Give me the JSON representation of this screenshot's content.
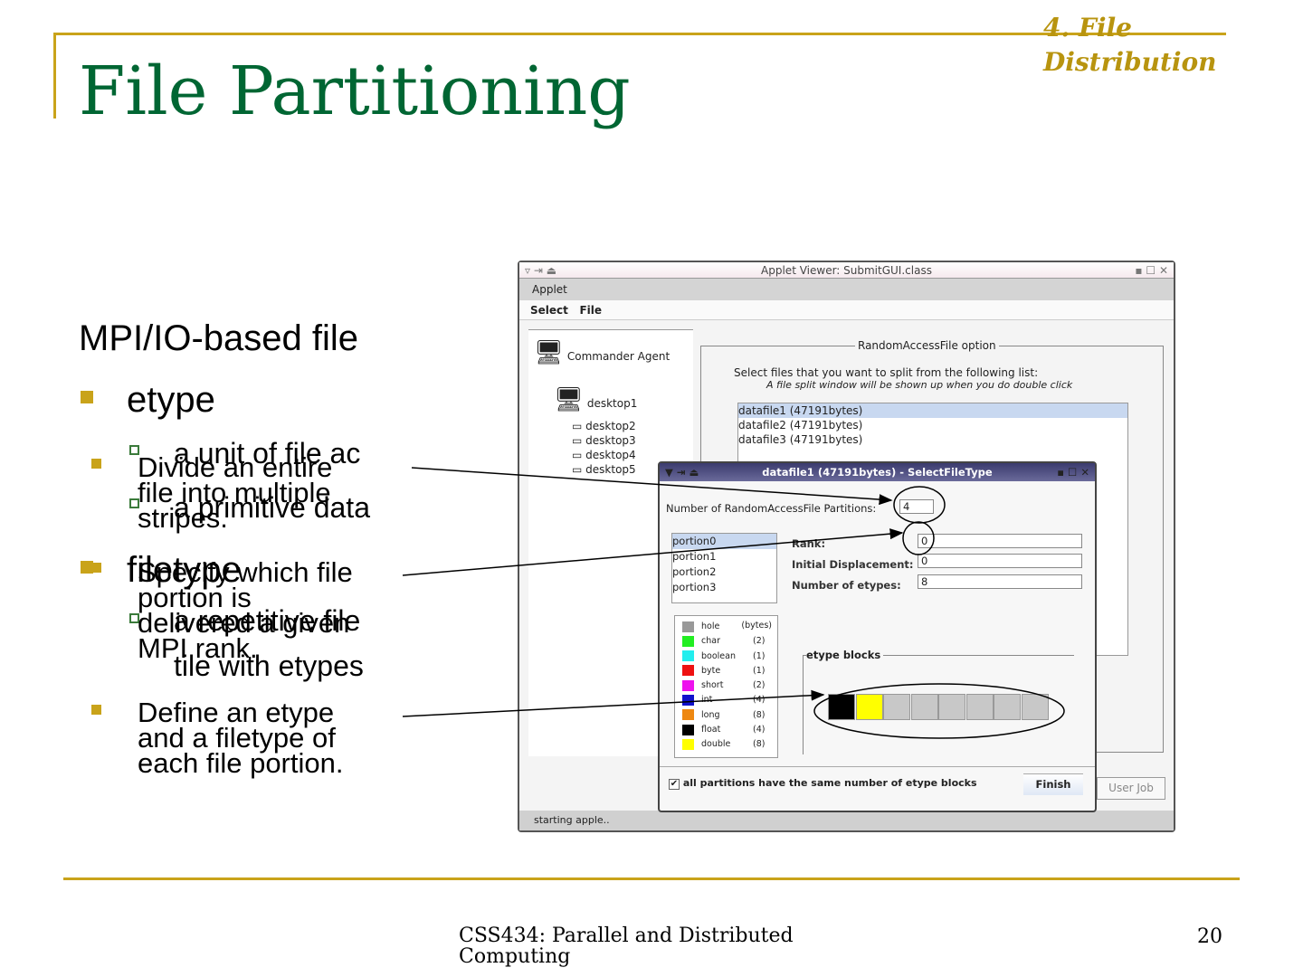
{
  "slide": {
    "title": "File Partitioning",
    "section": [
      "4. File",
      "Distribution"
    ],
    "footer": [
      "CSS434: Parallel and Distributed",
      "Computing"
    ],
    "page_number": "20"
  },
  "background_text": {
    "heading": "MPI/IO-based file",
    "items": [
      {
        "label": "etype",
        "subs": [
          "a unit of file ac",
          "a primitive data"
        ]
      },
      {
        "label": "filetype",
        "subs": [
          "a repetitive file",
          "tile with etypes"
        ]
      }
    ]
  },
  "bullets": [
    [
      "Divide an entire",
      "file into multiple",
      "stripes."
    ],
    [
      "Specify which file",
      "portion is",
      "delivered a given",
      "MPI rank."
    ],
    [
      "Define an etype",
      "and a filetype of",
      "each file portion."
    ]
  ],
  "applet": {
    "title": "Applet Viewer: SubmitGUI.class",
    "menu": "Applet",
    "menubar": [
      "Select",
      "File"
    ],
    "tree": [
      "Commander Agent",
      "desktop1",
      "desktop2",
      "desktop3",
      "desktop4",
      "desktop5"
    ],
    "group_title": "RandomAccessFile option",
    "instruction": "Select files that you want to split from the following list:",
    "hint": "A file split window will be shown up when you do double click",
    "files": [
      "datafile1 (47191bytes)",
      "datafile2 (47191bytes)",
      "datafile3 (47191bytes)"
    ],
    "user_job_button": "User Job",
    "status": "starting apple.."
  },
  "dialog": {
    "title": "datafile1 (47191bytes) - SelectFileType",
    "partitions_label": "Number of RandomAccessFile Partitions:",
    "partitions_value": "4",
    "portions": [
      "portion0",
      "portion1",
      "portion2",
      "portion3"
    ],
    "rank_label": "Rank:",
    "rank_value": "0",
    "disp_label": "Initial Displacement:",
    "disp_value": "0",
    "num_label": "Number of etypes:",
    "num_value": "8",
    "legend_header": "(bytes)",
    "legend": [
      {
        "name": "hole",
        "size": "",
        "color": "#999999"
      },
      {
        "name": "char",
        "size": "(2)",
        "color": "#22ee22"
      },
      {
        "name": "boolean",
        "size": "(1)",
        "color": "#22eeee"
      },
      {
        "name": "byte",
        "size": "(1)",
        "color": "#ee1111"
      },
      {
        "name": "short",
        "size": "(2)",
        "color": "#ee11ee"
      },
      {
        "name": "int",
        "size": "(4)",
        "color": "#1111cc"
      },
      {
        "name": "long",
        "size": "(8)",
        "color": "#ee8811"
      },
      {
        "name": "float",
        "size": "(4)",
        "color": "#000000"
      },
      {
        "name": "double",
        "size": "(8)",
        "color": "#ffff00"
      }
    ],
    "blocks_title": "etype blocks",
    "blocks": [
      "#000000",
      "#ffff00",
      "#c8c8c8",
      "#c8c8c8",
      "#c8c8c8",
      "#c8c8c8",
      "#c8c8c8",
      "#c8c8c8"
    ],
    "checkbox_label": "all partitions have the same number of etype blocks",
    "checkbox_checked": true,
    "finish": "Finish"
  }
}
